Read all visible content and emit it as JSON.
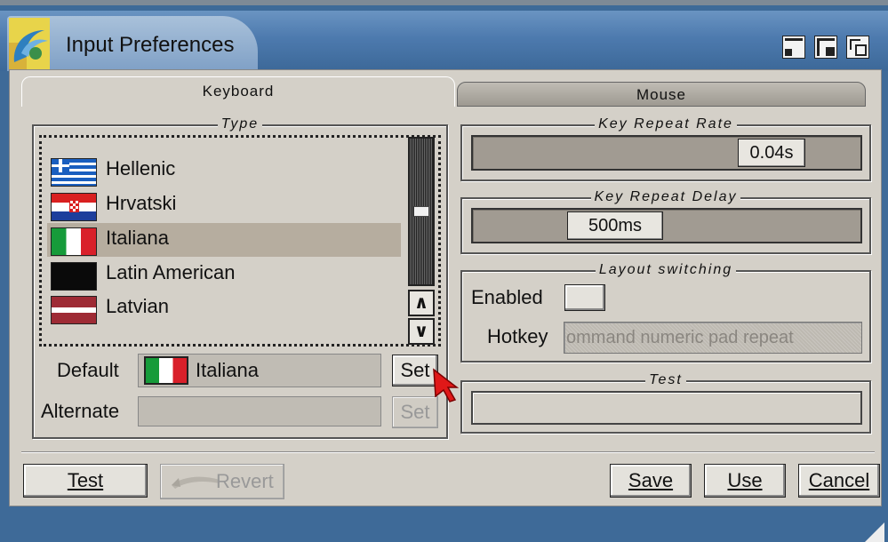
{
  "window": {
    "title": "Input Preferences",
    "controls": [
      "minimize-icon",
      "maximize-icon",
      "restore-icon"
    ],
    "accent": "#4d7aae"
  },
  "tabs": [
    {
      "label": "Keyboard",
      "active": true
    },
    {
      "label": "Mouse",
      "active": false
    }
  ],
  "type_group": {
    "legend": "Type",
    "items": [
      {
        "label": "Hellenic",
        "flag": "greece-flag-icon",
        "selected": false
      },
      {
        "label": "Hrvatski",
        "flag": "croatia-flag-icon",
        "selected": false
      },
      {
        "label": "Italiana",
        "flag": "italy-flag-icon",
        "selected": true
      },
      {
        "label": "Latin American",
        "flag": "black-flag-icon",
        "selected": false
      },
      {
        "label": "Latvian",
        "flag": "latvia-flag-icon",
        "selected": false
      }
    ],
    "default_label": "Default",
    "default_value": "Italiana",
    "alternate_label": "Alternate",
    "alternate_value": "",
    "set_label": "Set",
    "set_alt_label": "Set"
  },
  "key_repeat_rate": {
    "legend": "Key Repeat Rate",
    "value": "0.04s"
  },
  "key_repeat_delay": {
    "legend": "Key Repeat Delay",
    "value": "500ms"
  },
  "layout_switching": {
    "legend": "Layout switching",
    "enabled_label": "Enabled",
    "hotkey_label": "Hotkey",
    "hotkey_value": "ommand numeric pad repeat"
  },
  "test_group": {
    "legend": "Test",
    "value": ""
  },
  "footer": {
    "test_label": "Test",
    "revert_label": "Revert",
    "save_label": "Save",
    "use_label": "Use",
    "cancel_label": "Cancel"
  }
}
